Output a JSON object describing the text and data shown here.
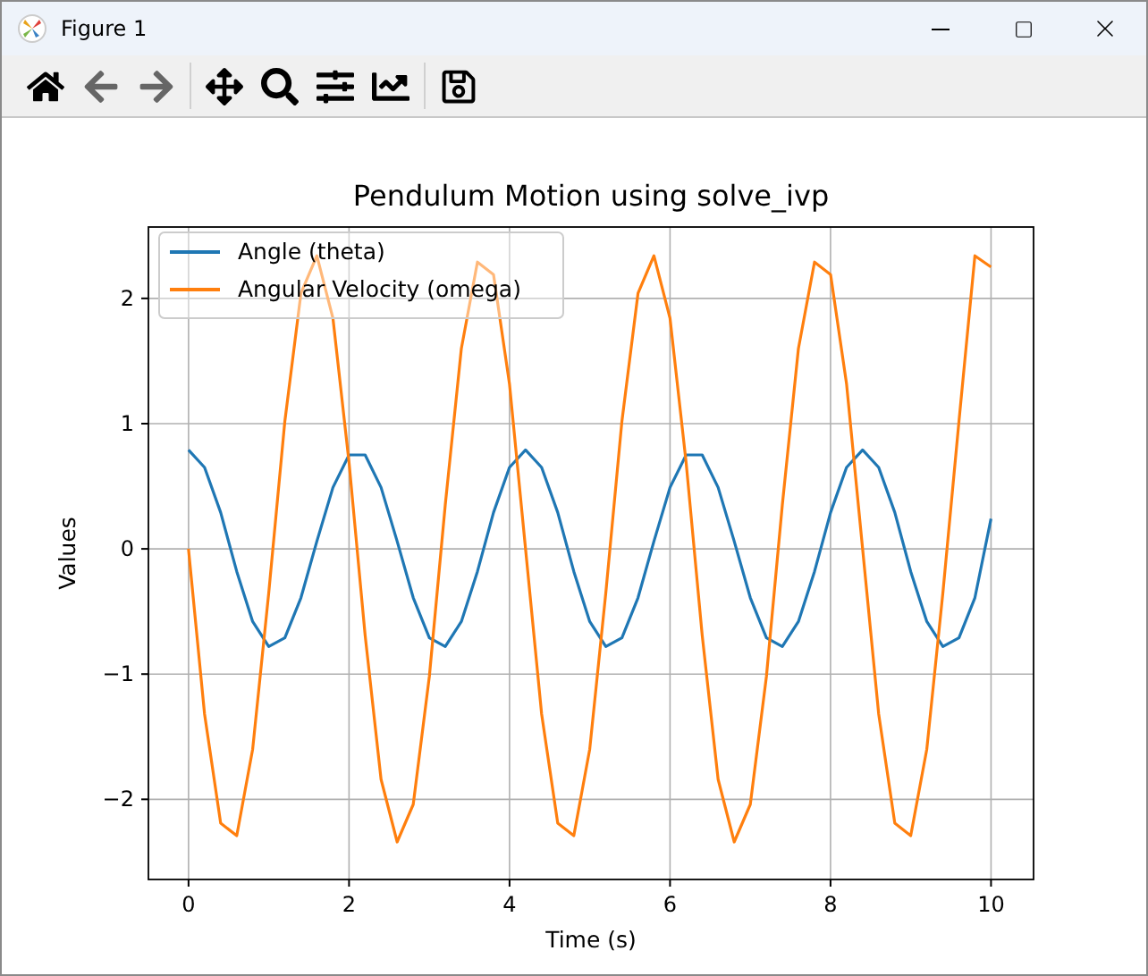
{
  "window": {
    "title": "Figure 1"
  },
  "chart_data": {
    "type": "line",
    "title": "Pendulum Motion using solve_ivp",
    "xlabel": "Time (s)",
    "ylabel": "Values",
    "x": [
      0,
      0.2,
      0.4,
      0.6,
      0.8,
      1,
      1.2,
      1.4,
      1.6,
      1.8,
      2,
      2.2,
      2.4,
      2.6,
      2.8,
      3,
      3.2,
      3.4,
      3.6,
      3.8,
      4,
      4.2,
      4.4,
      4.6,
      4.8,
      5,
      5.2,
      5.4,
      5.6,
      5.8,
      6,
      6.2,
      6.4,
      6.6,
      6.8,
      7,
      7.2,
      7.4,
      7.6,
      7.8,
      8,
      8.2,
      8.4,
      8.6,
      8.8,
      9,
      9.2,
      9.4,
      9.6,
      9.8,
      10
    ],
    "series": [
      {
        "name": "Angle (theta)",
        "color": "#1f77b4",
        "values": [
          0.79,
          0.65,
          0.29,
          -0.18,
          -0.58,
          -0.78,
          -0.71,
          -0.39,
          0.06,
          0.49,
          0.75,
          0.75,
          0.49,
          0.06,
          -0.39,
          -0.71,
          -0.78,
          -0.58,
          -0.18,
          0.29,
          0.65,
          0.79,
          0.65,
          0.29,
          -0.18,
          -0.58,
          -0.78,
          -0.71,
          -0.39,
          0.06,
          0.49,
          0.75,
          0.75,
          0.49,
          0.06,
          -0.39,
          -0.71,
          -0.78,
          -0.58,
          -0.18,
          0.29,
          0.65,
          0.79,
          0.65,
          0.29,
          -0.18,
          -0.58,
          -0.78,
          -0.71,
          -0.39,
          0.24
        ]
      },
      {
        "name": "Angular Velocity (omega)",
        "color": "#ff7f0e",
        "values": [
          0,
          -1.32,
          -2.19,
          -2.29,
          -1.6,
          -0.35,
          1.02,
          2.04,
          2.34,
          1.84,
          0.69,
          -0.69,
          -1.84,
          -2.34,
          -2.04,
          -1.02,
          0.35,
          1.6,
          2.29,
          2.19,
          1.32,
          0,
          -1.32,
          -2.19,
          -2.29,
          -1.6,
          -0.35,
          1.02,
          2.04,
          2.34,
          1.84,
          0.69,
          -0.69,
          -1.84,
          -2.34,
          -2.04,
          -1.02,
          0.35,
          1.6,
          2.29,
          2.19,
          1.32,
          0,
          -1.32,
          -2.19,
          -2.29,
          -1.6,
          -0.35,
          1.02,
          2.34,
          2.25
        ]
      }
    ],
    "xlim": [
      -0.5,
      10.53
    ],
    "ylim": [
      -2.64,
      2.57
    ],
    "xticks": [
      0,
      2,
      4,
      6,
      8,
      10
    ],
    "yticks": [
      {
        "value": -2,
        "label": "−2"
      },
      {
        "value": -1,
        "label": "−1"
      },
      {
        "value": 0,
        "label": "0"
      },
      {
        "value": 1,
        "label": "1"
      },
      {
        "value": 2,
        "label": "2"
      }
    ],
    "grid": true,
    "legend": true
  }
}
